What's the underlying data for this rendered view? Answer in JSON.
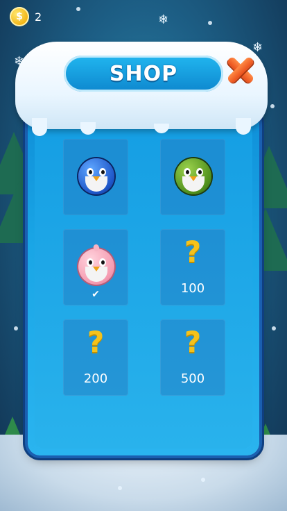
{
  "hud": {
    "coin_icon": "coin-icon",
    "coins": "2"
  },
  "header": {
    "title": "SHOP"
  },
  "close_icon": "close-x-icon",
  "shop": {
    "items": [
      {
        "kind": "character",
        "color": "blue",
        "price": "",
        "selected": false
      },
      {
        "kind": "character",
        "color": "green",
        "price": "",
        "selected": false
      },
      {
        "kind": "character",
        "color": "pink",
        "price": "",
        "selected": true,
        "check": "✔"
      },
      {
        "kind": "locked",
        "qmark": "?",
        "price": "100"
      },
      {
        "kind": "locked",
        "qmark": "?",
        "price": "200"
      },
      {
        "kind": "locked",
        "qmark": "?",
        "price": "500"
      }
    ]
  },
  "colors": {
    "panel": "#159ee3",
    "accent_close": "#e84f1b",
    "coin": "#f2b20f"
  }
}
